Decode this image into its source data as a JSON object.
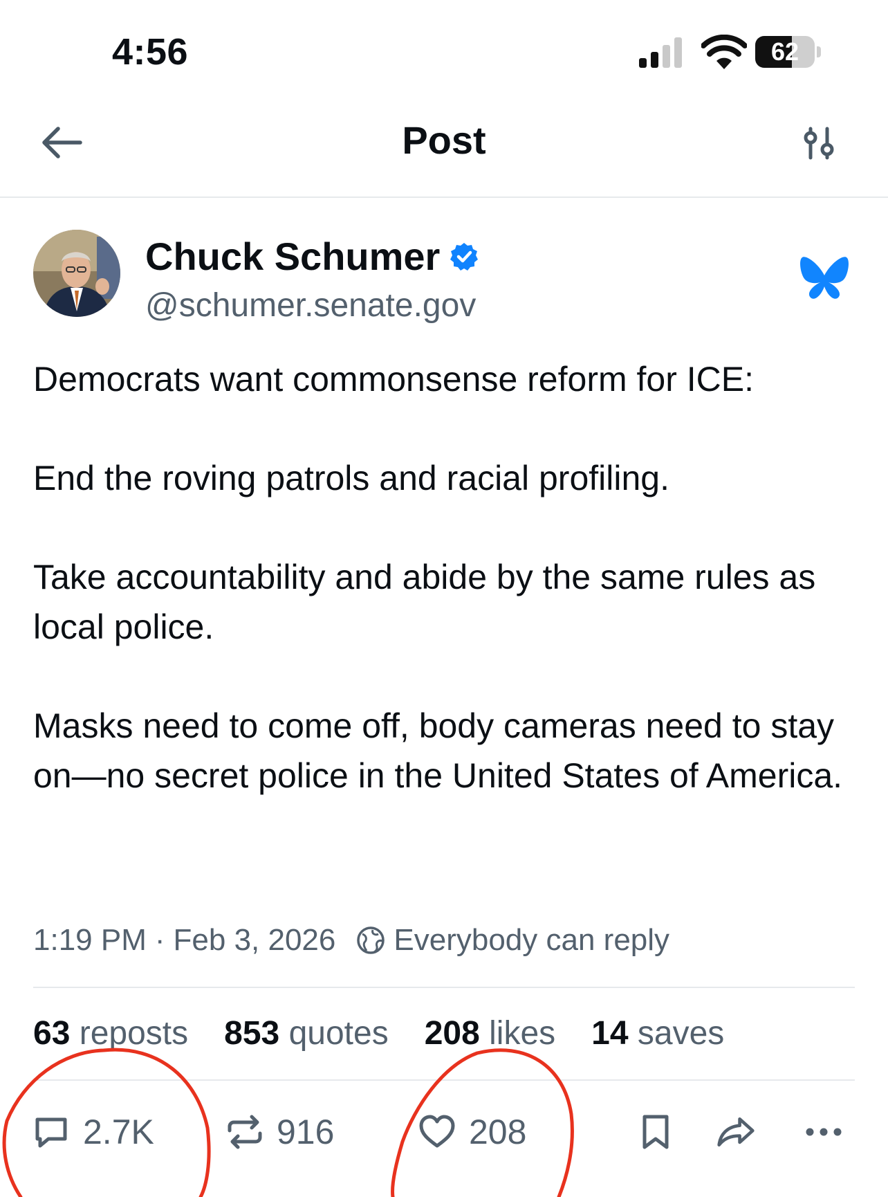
{
  "status_bar": {
    "time": "4:56",
    "battery_percent": "62",
    "battery_level": 0.62
  },
  "header": {
    "title": "Post"
  },
  "post": {
    "author": {
      "name": "Chuck Schumer",
      "handle": "@schumer.senate.gov",
      "verified": true
    },
    "paragraphs": [
      "Democrats want commonsense reform for ICE:",
      "End the roving patrols and racial profiling.",
      "Take accountability and abide by the same rules as local police.",
      "Masks need to come off, body cameras need to stay on—no secret police in the United States of America."
    ],
    "timestamp": "1:19 PM",
    "date": "Feb 3, 2026",
    "separator": "·",
    "reply_setting": "Everybody can reply",
    "stats": {
      "reposts_count": "63",
      "reposts_label": "reposts",
      "quotes_count": "853",
      "quotes_label": "quotes",
      "likes_count": "208",
      "likes_label": "likes",
      "saves_count": "14",
      "saves_label": "saves"
    },
    "actions": {
      "replies": "2.7K",
      "reposts": "916",
      "likes": "208"
    }
  },
  "colors": {
    "text": "#0b0f14",
    "muted": "#53606d",
    "verified_blue": "#1083fe",
    "bluesky_blue": "#1185fe",
    "annotation_red": "#e8321e",
    "divider": "#e6e9ec"
  },
  "icons": {
    "back": "arrow-left-icon",
    "filter": "sliders-icon",
    "verified": "verified-check-icon",
    "app": "bluesky-butterfly-icon",
    "reply_setting": "globe-icon",
    "reply": "chat-bubble-icon",
    "repost": "repost-icon",
    "like": "heart-icon",
    "bookmark": "bookmark-icon",
    "share": "share-arrow-icon",
    "more": "more-dots-icon"
  }
}
